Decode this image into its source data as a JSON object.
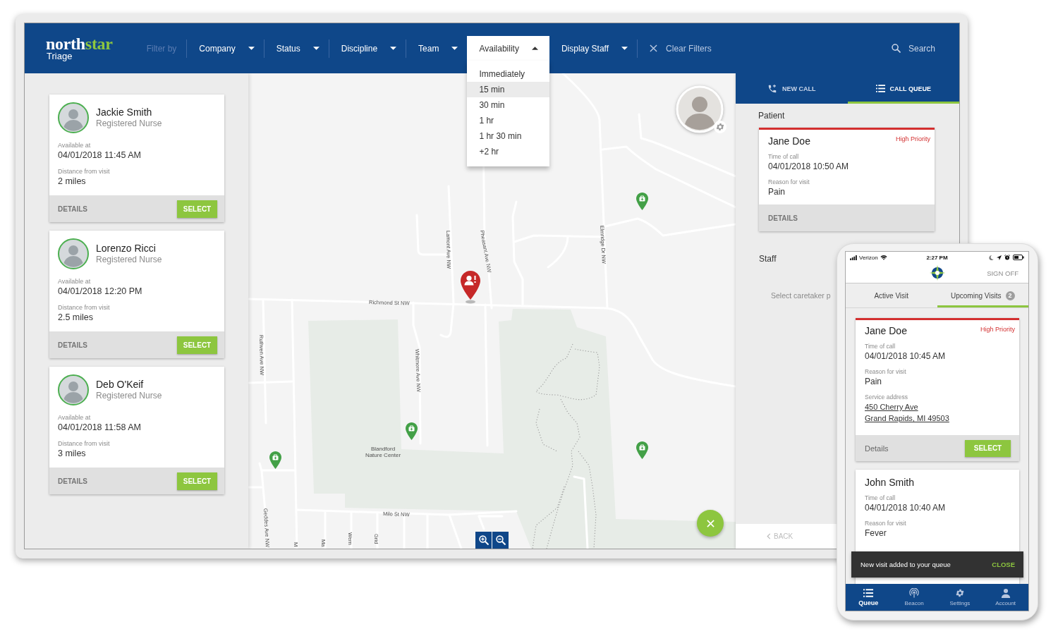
{
  "navbar": {
    "brand": {
      "name_start": "north",
      "name_end": "star",
      "product": "Triage"
    },
    "filter_label": "Filter by",
    "filters": [
      {
        "label": "Company",
        "expanded": false
      },
      {
        "label": "Status",
        "expanded": false
      },
      {
        "label": "Discipline",
        "expanded": false
      },
      {
        "label": "Team",
        "expanded": false
      },
      {
        "label": "Availability",
        "expanded": true,
        "options": [
          {
            "label": "Immediately",
            "selected": false
          },
          {
            "label": "15 min",
            "selected": true
          },
          {
            "label": "30 min",
            "selected": false
          },
          {
            "label": "1 hr",
            "selected": false
          },
          {
            "label": "1 hr 30 min",
            "selected": false
          },
          {
            "label": "+2 hr",
            "selected": false
          }
        ]
      },
      {
        "label": "Display Staff",
        "expanded": false
      }
    ],
    "clear_filters": "Clear Filters",
    "search": "Search"
  },
  "staff_cards": [
    {
      "name": "Jackie Smith",
      "role": "Registered Nurse",
      "fields": [
        {
          "label": "Available at",
          "value": "04/01/2018 11:45 AM"
        },
        {
          "label": "Distance from visit",
          "value": "2 miles"
        }
      ],
      "details": "DETAILS",
      "select": "SELECT"
    },
    {
      "name": "Lorenzo Ricci",
      "role": "Registered Nurse",
      "fields": [
        {
          "label": "Available at",
          "value": "04/01/2018 12:20 PM"
        },
        {
          "label": "Distance from visit",
          "value": "2.5 miles"
        }
      ],
      "details": "DETAILS",
      "select": "SELECT"
    },
    {
      "name": "Deb O'Keif",
      "role": "Registered Nurse",
      "fields": [
        {
          "label": "Available at",
          "value": "04/01/2018 11:58 AM"
        },
        {
          "label": "Distance from visit",
          "value": "3 miles"
        }
      ],
      "details": "DETAILS",
      "select": "SELECT"
    }
  ],
  "map": {
    "street_labels": [
      "Richmond St NW",
      "Lamont Ave NW",
      "Pheasant Ave NW",
      "Elmridge Dr NW",
      "Ruthven Ave NW",
      "Whitmore Ave NW",
      "Milo St NW",
      "Geddes Ave NW",
      "M",
      "Ma",
      "Wern",
      "Grid"
    ],
    "place_label": "Blandford Nature Center"
  },
  "call_panel": {
    "tabs": [
      {
        "label": "NEW CALL",
        "selected": false
      },
      {
        "label": "CALL QUEUE",
        "selected": true
      }
    ],
    "patient_heading": "Patient",
    "patient": {
      "name": "Jane Doe",
      "priority": "High Priority",
      "high_priority": true,
      "fields": [
        {
          "label": "Time of call",
          "value": "04/01/2018 10:50 AM"
        },
        {
          "label": "Reason for visit",
          "value": "Pain"
        }
      ],
      "details": "DETAILS"
    },
    "staff_heading": "Staff",
    "staff_hint": "Select caretaker p",
    "back": "BACK"
  },
  "phone": {
    "status_bar": {
      "carrier": "Verizon",
      "time": "2:27 PM"
    },
    "sign_off": "SIGN OFF",
    "tabs": [
      {
        "label": "Active Visit",
        "selected": false
      },
      {
        "label": "Upcoming Visits",
        "selected": true,
        "badge": "2"
      }
    ],
    "visits": [
      {
        "name": "Jane Doe",
        "priority": "High Priority",
        "high_priority": true,
        "fields": [
          {
            "kind": "text",
            "label": "Time of call",
            "value": "04/01/2018 10:45 AM"
          },
          {
            "kind": "text",
            "label": "Reason for visit",
            "value": "Pain"
          },
          {
            "kind": "address",
            "label": "Service address",
            "lines": [
              "450 Cherry Ave",
              "Grand Rapids, MI 49503"
            ]
          }
        ],
        "details": "Details",
        "select": "SELECT"
      },
      {
        "name": "John Smith",
        "high_priority": false,
        "fields": [
          {
            "kind": "text",
            "label": "Time of call",
            "value": "04/01/2018 10:40 AM"
          },
          {
            "kind": "text",
            "label": "Reason for visit",
            "value": "Fever"
          }
        ]
      }
    ],
    "snackbar": {
      "message": "New visit added to your queue",
      "action": "CLOSE"
    },
    "bottom_nav": [
      {
        "label": "Queue",
        "selected": true
      },
      {
        "label": "Beacon",
        "selected": false
      },
      {
        "label": "Settings",
        "selected": false
      },
      {
        "label": "Account",
        "selected": false
      }
    ]
  }
}
